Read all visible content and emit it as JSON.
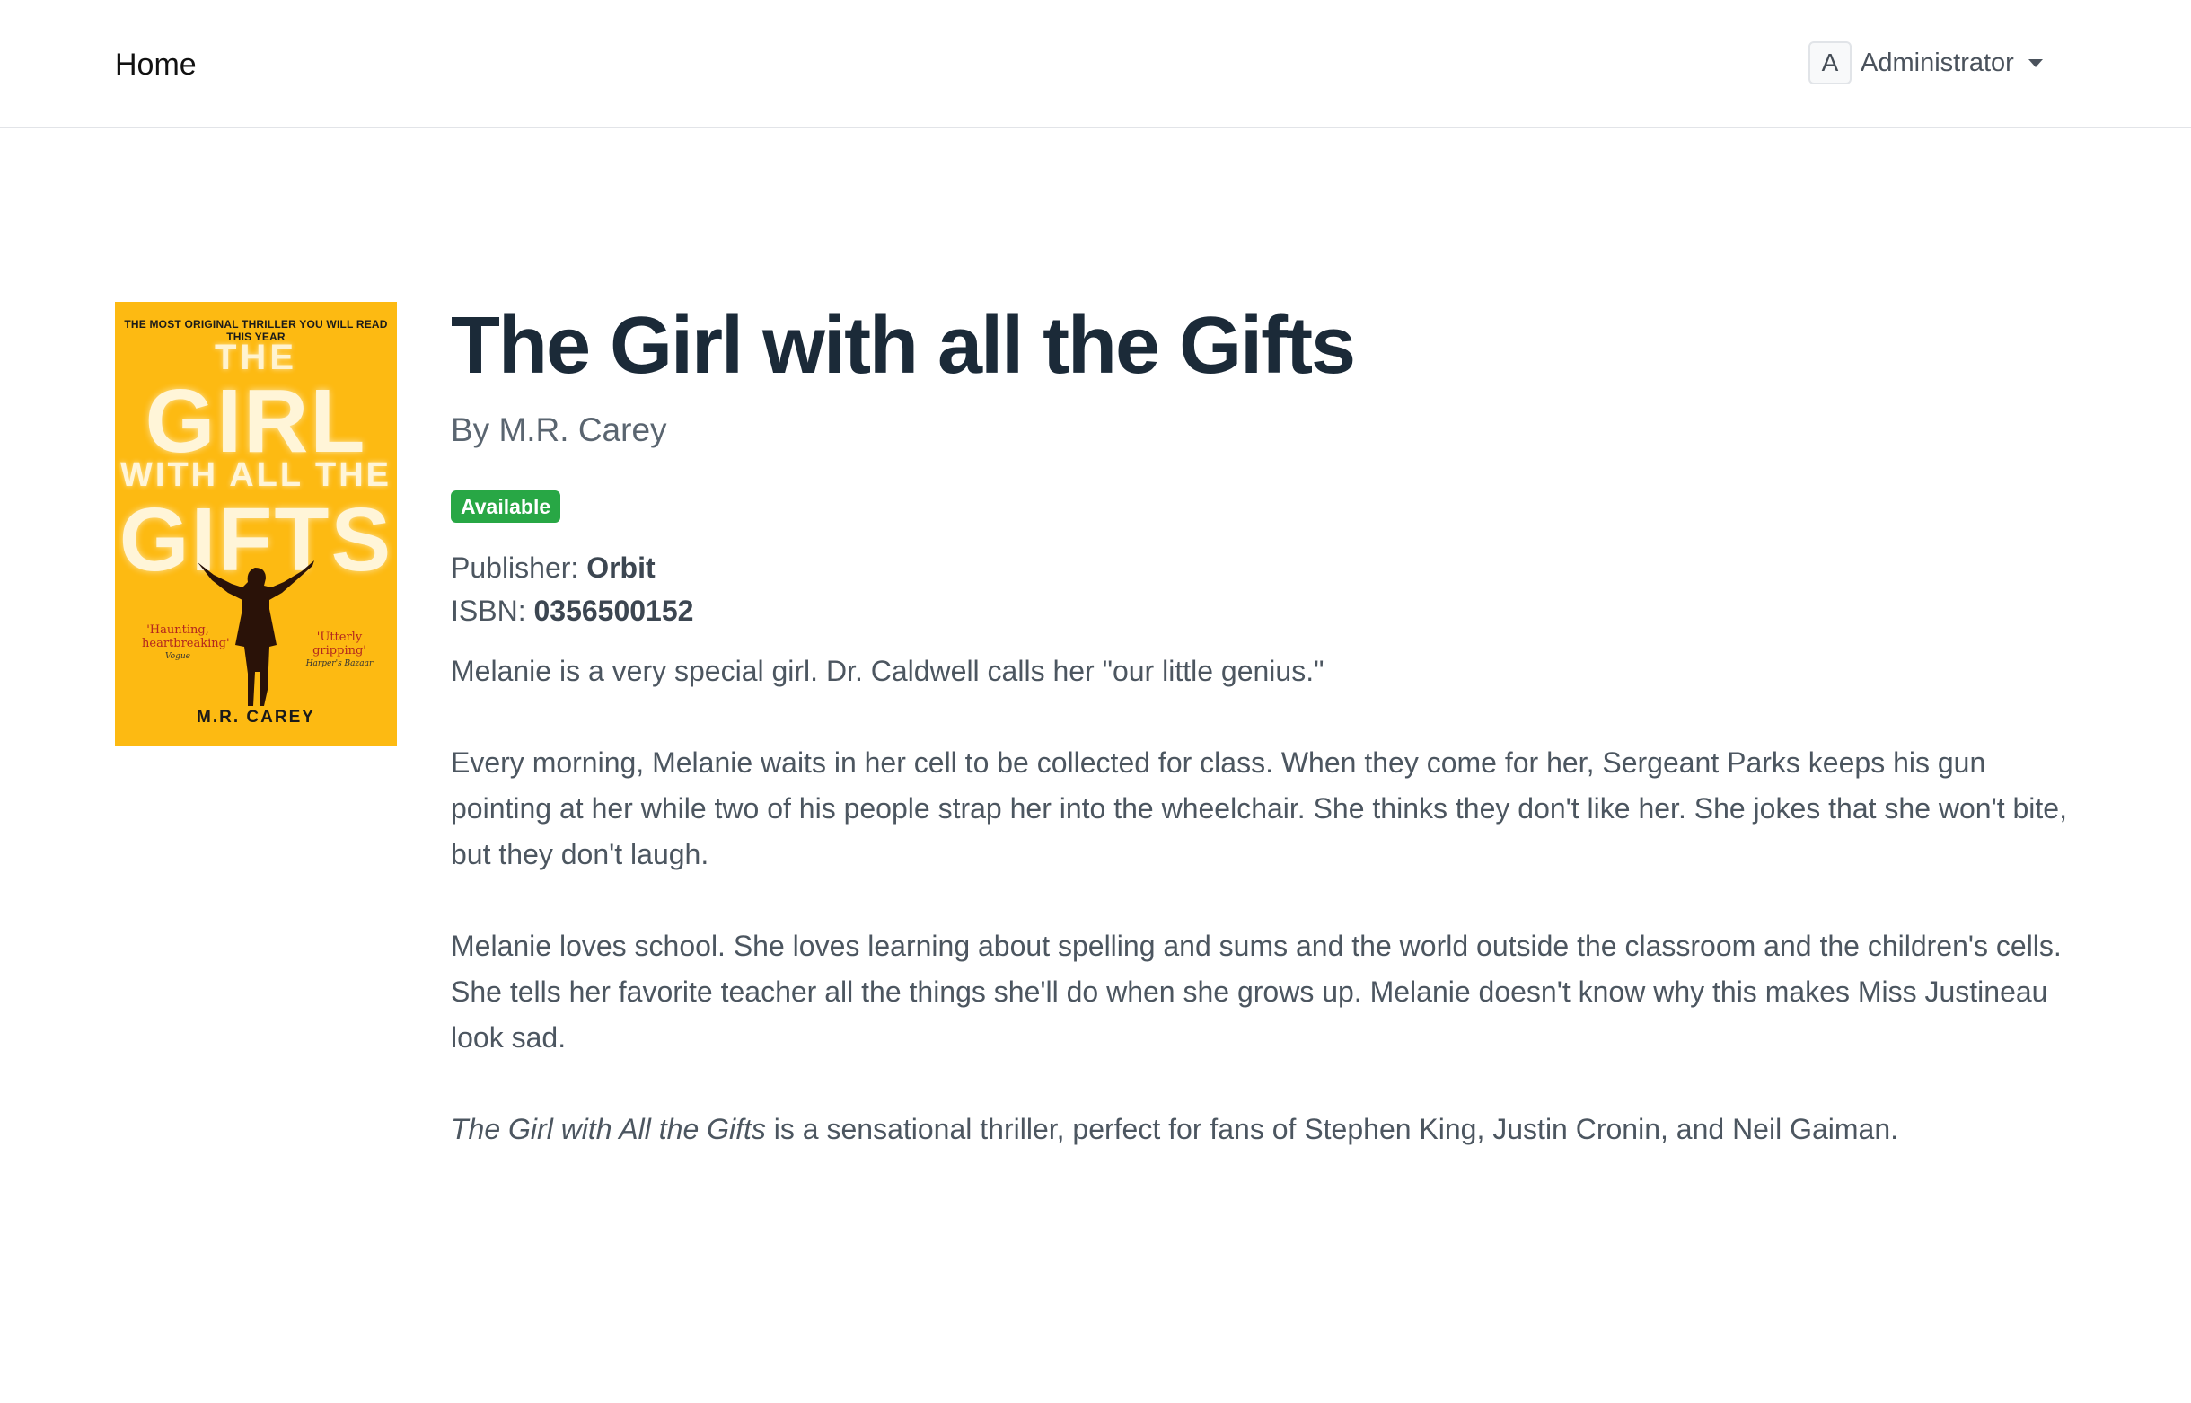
{
  "nav": {
    "home_label": "Home",
    "user_initial": "A",
    "user_name": "Administrator"
  },
  "cover": {
    "tagline": "THE MOST ORIGINAL THRILLER YOU WILL READ THIS YEAR",
    "title_the": "THE",
    "title_girl": "GIRL",
    "title_with_all_the": "WITH ALL THE",
    "title_gifts": "GIFTS",
    "quote_left": "'Haunting, heartbreaking'",
    "quote_left_source": "Vogue",
    "quote_right": "'Utterly gripping'",
    "quote_right_source": "Harper's Bazaar",
    "author": "M.R. CAREY",
    "background_color": "#fdba12"
  },
  "book": {
    "title": "The Girl with all the Gifts",
    "byline": "By M.R. Carey",
    "status_badge": "Available",
    "status_color": "#28a745",
    "publisher_label": "Publisher:",
    "publisher": "Orbit",
    "isbn_label": "ISBN:",
    "isbn": "0356500152",
    "description": {
      "p1": "Melanie is a very special girl. Dr. Caldwell calls her \"our little genius.\"",
      "p2": "Every morning, Melanie waits in her cell to be collected for class. When they come for her, Sergeant Parks keeps his gun pointing at her while two of his people strap her into the wheelchair. She thinks they don't like her. She jokes that she won't bite, but they don't laugh.",
      "p3": "Melanie loves school. She loves learning about spelling and sums and the world outside the classroom and the children's cells. She tells her favorite teacher all the things she'll do when she grows up. Melanie doesn't know why this makes Miss Justineau look sad.",
      "p4_italic": "The Girl with All the Gifts",
      "p4_rest": " is a sensational thriller, perfect for fans of Stephen King, Justin Cronin, and Neil Gaiman."
    }
  }
}
